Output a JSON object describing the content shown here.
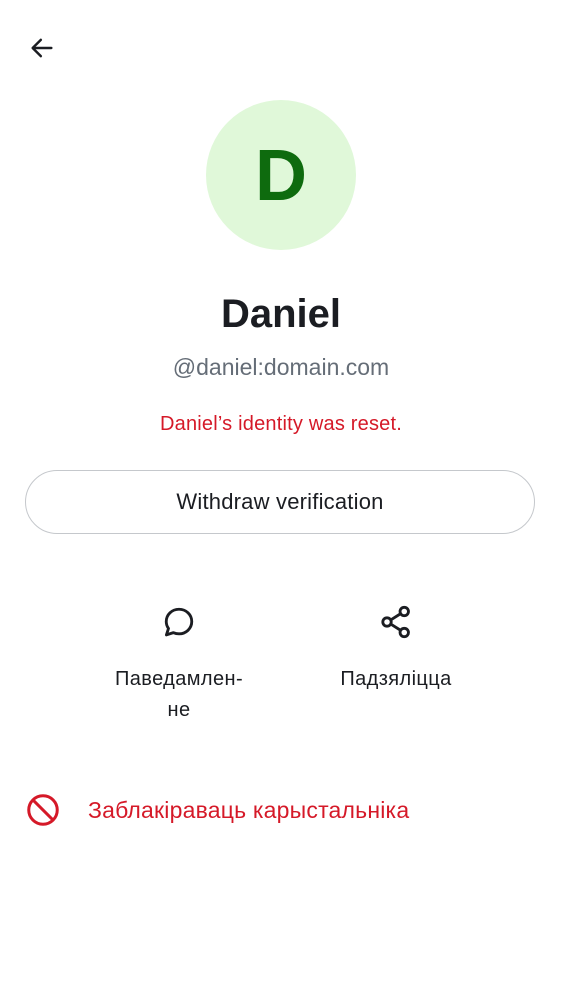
{
  "header": {
    "back_icon": "arrow-left-icon"
  },
  "profile": {
    "avatar_letter": "D",
    "avatar_bg_color": "#e0f8d9",
    "avatar_fg_color": "#0e6b0e",
    "display_name": "Daniel",
    "user_id": "@daniel:domain.com",
    "identity_warning": "Daniel’s identity was reset.",
    "warning_color": "#d51928"
  },
  "verification": {
    "withdraw_label": "Withdraw verification"
  },
  "actions": [
    {
      "icon": "chat-bubble-icon",
      "label": "Паведамлен-\nне"
    },
    {
      "icon": "share-icon",
      "label": "Падзяліцца"
    }
  ],
  "danger": {
    "icon": "block-icon",
    "block_label": "Заблакіраваць карыстальніка"
  }
}
